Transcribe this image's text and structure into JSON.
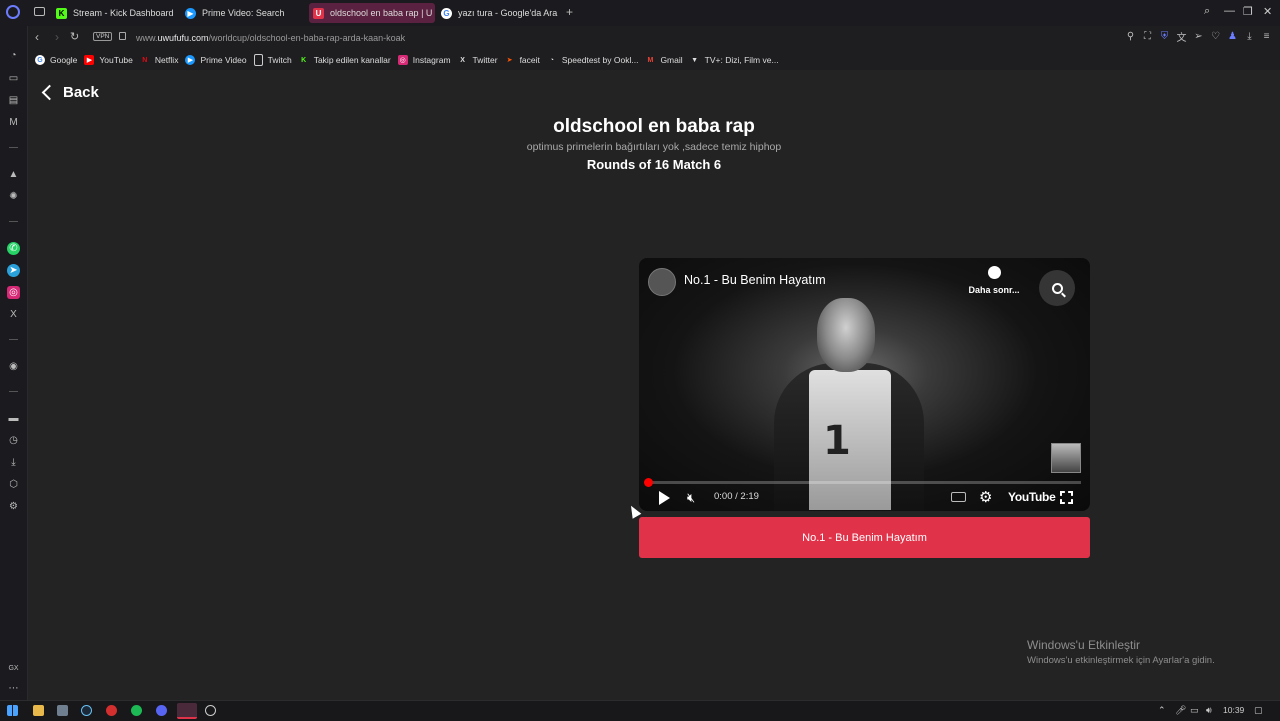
{
  "browser": {
    "tabs": [
      {
        "label": "Stream - Kick Dashboard",
        "icon": "kick-icon",
        "color": "#53fc18",
        "glyph": "K"
      },
      {
        "label": "Prime Video: Search",
        "icon": "prime-video-icon",
        "color": "#1a98ff",
        "glyph": "▶"
      },
      {
        "label": "oldschool en baba rap | U",
        "icon": "uwufufu-icon",
        "color": "#e0334a",
        "glyph": "U"
      },
      {
        "label": "yazı tura - Google'da Ara",
        "icon": "google-icon",
        "color": "#4285f4",
        "glyph": "G"
      }
    ],
    "url_prefix": "www.",
    "url_host": "uwufufu.com",
    "url_path": "/worldcup/oldschool-en-baba-rap-arda-kaan-koak",
    "vpn_label": "VPN",
    "bookmarks": [
      {
        "label": "Google",
        "icon": "google-icon",
        "color": "#4285f4",
        "glyph": "G"
      },
      {
        "label": "YouTube",
        "icon": "youtube-icon",
        "color": "#ff0000",
        "glyph": "▶"
      },
      {
        "label": "Netflix",
        "icon": "netflix-icon",
        "color": "#e50914",
        "glyph": "N"
      },
      {
        "label": "Prime Video",
        "icon": "prime-video-icon",
        "color": "#1a98ff",
        "glyph": "▶"
      },
      {
        "label": "Twitch",
        "icon": "page-icon",
        "color": "#444444",
        "glyph": "▯"
      },
      {
        "label": "Takip edilen kanallar",
        "icon": "kick-icon",
        "color": "#53fc18",
        "glyph": "K"
      },
      {
        "label": "Instagram",
        "icon": "instagram-icon",
        "color": "#d62976",
        "glyph": "◎"
      },
      {
        "label": "Twitter",
        "icon": "x-icon",
        "color": "#000000",
        "glyph": "X"
      },
      {
        "label": "faceit",
        "icon": "faceit-icon",
        "color": "#ff5500",
        "glyph": "➤"
      },
      {
        "label": "Speedtest by Ookl...",
        "icon": "speedtest-icon",
        "color": "#555555",
        "glyph": "◔"
      },
      {
        "label": "Gmail",
        "icon": "gmail-icon",
        "color": "#ea4335",
        "glyph": "M"
      },
      {
        "label": "TV+: Dizi, Film ve...",
        "icon": "tvplus-icon",
        "color": "#333333",
        "glyph": "▼"
      }
    ]
  },
  "page": {
    "back_label": "Back",
    "title": "oldschool en baba rap",
    "subtitle": "optimus primelerin bağırtıları yok ,sadece temiz hiphop",
    "round": "Rounds of 16 Match 6",
    "video": {
      "title": "No.1 - Bu Benim Hayatım",
      "watch_later": "Daha sonr...",
      "time": "0:00 / 2:19",
      "progress": 0.0,
      "youtube_logo": "YouTube",
      "shirt_number": "1"
    },
    "vote_button": "No.1 - Bu Benim Hayatım",
    "accent_color": "#e0334a"
  },
  "windows_activation": {
    "title": "Windows'u Etkinleştir",
    "message": "Windows'u etkinleştirmek için Ayarlar'a gidin."
  },
  "taskbar": {
    "clock": "10:39"
  }
}
